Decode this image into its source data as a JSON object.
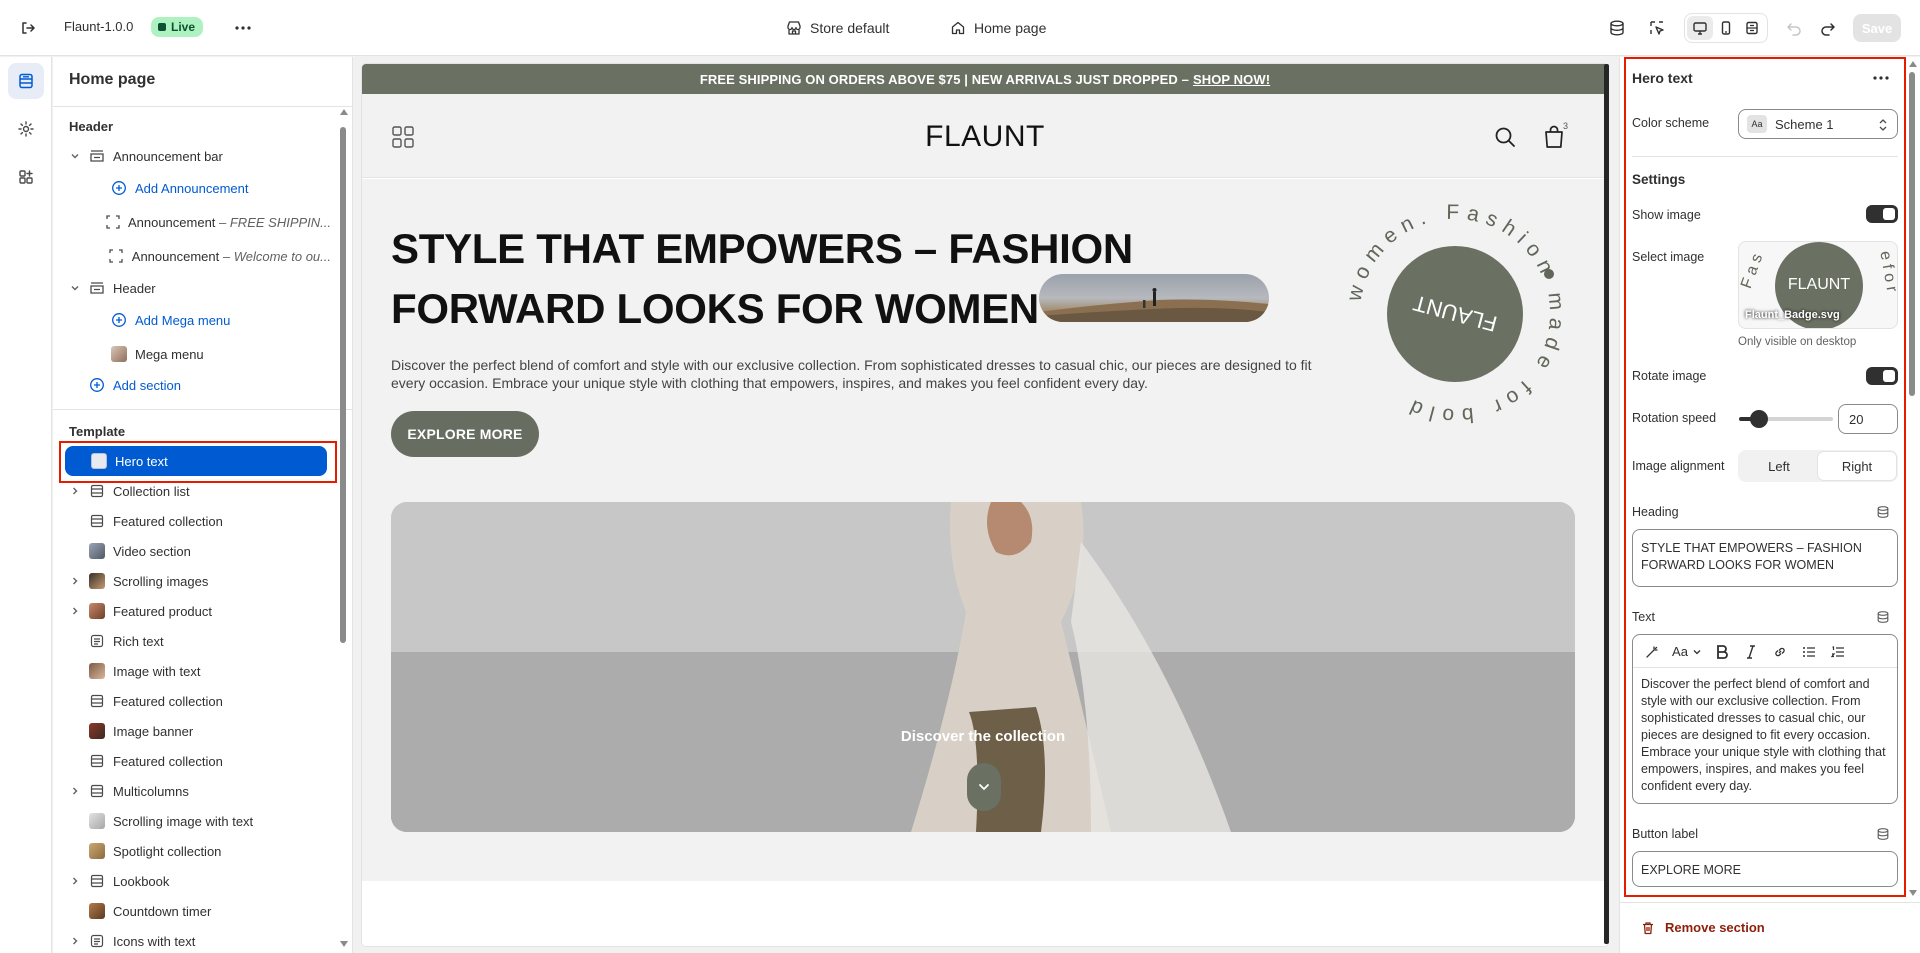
{
  "topbar": {
    "app_title": "Flaunt-1.0.0",
    "live_badge": "Live",
    "store_selector": "Store default",
    "page_selector": "Home page",
    "save_label": "Save"
  },
  "sidebar": {
    "title": "Home page",
    "header_group": "Header",
    "header_items": [
      {
        "label": "Announcement bar"
      },
      {
        "label": "Add Announcement"
      },
      {
        "label": "Announcement",
        "detail": " – FREE SHIPPIN..."
      },
      {
        "label": "Announcement",
        "detail": " – Welcome to ou..."
      },
      {
        "label": "Header"
      },
      {
        "label": "Add Mega menu"
      },
      {
        "label": "Mega menu"
      },
      {
        "label": "Add section"
      }
    ],
    "template_group": "Template",
    "template_items": [
      {
        "label": "Hero text"
      },
      {
        "label": "Collection list"
      },
      {
        "label": "Featured collection"
      },
      {
        "label": "Video section"
      },
      {
        "label": "Scrolling images"
      },
      {
        "label": "Featured product"
      },
      {
        "label": "Rich text"
      },
      {
        "label": "Image with text"
      },
      {
        "label": "Featured collection"
      },
      {
        "label": "Image banner"
      },
      {
        "label": "Featured collection"
      },
      {
        "label": "Multicolumns"
      },
      {
        "label": "Scrolling image with text"
      },
      {
        "label": "Spotlight collection"
      },
      {
        "label": "Lookbook"
      },
      {
        "label": "Countdown timer"
      },
      {
        "label": "Icons with text"
      }
    ]
  },
  "preview": {
    "announcement": "FREE SHIPPING ON ORDERS ABOVE $75 | NEW ARRIVALS JUST DROPPED –",
    "announcement_link": "SHOP NOW!",
    "logo": "FLAUNT",
    "cart_count": "3",
    "hero_heading": "STYLE THAT EMPOWERS – FASHION FORWARD LOOKS FOR WOMEN",
    "hero_text": "Discover the perfect blend of comfort and style with our exclusive collection. From sophisticated dresses to casual chic, our pieces are designed to fit every occasion. Embrace your unique style with clothing that empowers, inspires, and makes you feel confident every day.",
    "hero_button": "EXPLORE MORE",
    "badge_center": "FLAUNT",
    "badge_ring_text": "women. Fashion made for bold",
    "feature_caption": "Discover the collection"
  },
  "settings_panel": {
    "title": "Hero text",
    "color_scheme_label": "Color scheme",
    "color_scheme_swatch": "Aa",
    "color_scheme_value": "Scheme 1",
    "settings_heading": "Settings",
    "show_image_label": "Show image",
    "show_image_on": true,
    "select_image_label": "Select image",
    "image_filename": "Flaunt_Badge.svg",
    "image_badge_text": "FLAUNT",
    "image_help": "Only visible on desktop",
    "rotate_image_label": "Rotate image",
    "rotate_image_on": true,
    "rotation_speed_label": "Rotation speed",
    "rotation_speed_value": "20",
    "image_alignment_label": "Image alignment",
    "alignment_options": [
      "Left",
      "Right"
    ],
    "alignment_selected": "Right",
    "heading_label": "Heading",
    "heading_value": "STYLE THAT EMPOWERS – FASHION FORWARD LOOKS FOR WOMEN",
    "text_label": "Text",
    "rte_font_label": "Aa",
    "text_value": "Discover the perfect blend of comfort and style with our exclusive collection. From sophisticated dresses to casual chic, our pieces are designed to fit every occasion. Embrace your unique style with clothing that empowers, inspires, and makes you feel confident every day.",
    "button_label_label": "Button label",
    "button_label_value": "EXPLORE MORE",
    "remove_label": "Remove section"
  },
  "colors": {
    "accent": "#005bd3",
    "brand_green": "#6a7062",
    "live_bg": "#aff2c1",
    "danger": "#8e1f0b",
    "highlight_outline": "#e51c00"
  }
}
